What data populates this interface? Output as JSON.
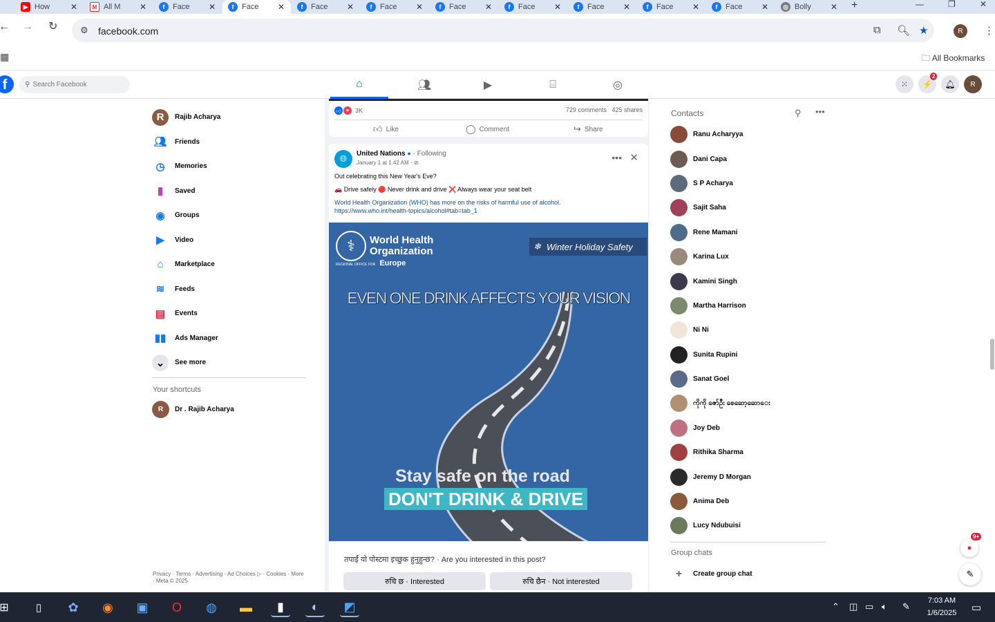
{
  "browser": {
    "tabs": [
      {
        "title": "How",
        "favicon": "youtube-icon",
        "active": false
      },
      {
        "title": "All M",
        "favicon": "gmail-icon",
        "active": false
      },
      {
        "title": "Face",
        "favicon": "facebook-icon",
        "active": false
      },
      {
        "title": "Face",
        "favicon": "facebook-icon",
        "active": true
      },
      {
        "title": "Face",
        "favicon": "facebook-icon",
        "active": false
      },
      {
        "title": "Face",
        "favicon": "facebook-icon",
        "active": false
      },
      {
        "title": "Face",
        "favicon": "facebook-icon",
        "active": false
      },
      {
        "title": "Face",
        "favicon": "facebook-icon",
        "active": false
      },
      {
        "title": "Face",
        "favicon": "facebook-icon",
        "active": false
      },
      {
        "title": "Face",
        "favicon": "facebook-icon",
        "active": false
      },
      {
        "title": "Face",
        "favicon": "facebook-icon",
        "active": false
      },
      {
        "title": "Bolly",
        "favicon": "globe-icon",
        "active": false
      }
    ],
    "url": "facebook.com",
    "bookmarks_label": "All Bookmarks"
  },
  "fb_header": {
    "search_placeholder": "Search Facebook",
    "messenger_badge": "2"
  },
  "left_nav": {
    "items": [
      {
        "label": "Rajib Acharya",
        "icon": "profile-avatar"
      },
      {
        "label": "Friends",
        "icon": "friends-icon"
      },
      {
        "label": "Memories",
        "icon": "clock-icon"
      },
      {
        "label": "Saved",
        "icon": "bookmark-icon"
      },
      {
        "label": "Groups",
        "icon": "groups-icon"
      },
      {
        "label": "Video",
        "icon": "video-icon"
      },
      {
        "label": "Marketplace",
        "icon": "marketplace-icon"
      },
      {
        "label": "Feeds",
        "icon": "feeds-icon"
      },
      {
        "label": "Events",
        "icon": "calendar-icon"
      },
      {
        "label": "Ads Manager",
        "icon": "bar-chart-icon"
      },
      {
        "label": "See more",
        "icon": "chevron-down-icon"
      }
    ],
    "shortcuts_title": "Your shortcuts",
    "shortcut": "Dr . Rajib Acharya",
    "footer": "Privacy · Terms · Advertising · Ad Choices ▷ · Cookies · More · Meta © 2025"
  },
  "top_card": {
    "reaction_count": "3K",
    "comments": "729 comments",
    "shares": "425 shares",
    "like": "Like",
    "comment": "Comment",
    "share": "Share"
  },
  "post": {
    "author": "United Nations",
    "following": "· Following",
    "date": "January 1 at 1:42 AM · ⊘",
    "line1": "Out celebrating this New Year's Eve?",
    "line2": "🚗 Drive safely 🔴 Never drink and drive ❌ Always wear your seat belt",
    "line3": "World Health Organization (WHO) has more on the risks of harmful use of alcohol.",
    "link": "https://www.who.int/health-topics/alcohol#tab=tab_1",
    "banner": {
      "org_line1": "World Health",
      "org_line2": "Organization",
      "org_region_small": "REGIONAL OFFICE FOR",
      "org_region": "Europe",
      "tag": "Winter Holiday Safety",
      "headline": "EVEN ONE DRINK AFFECTS YOUR VISION",
      "stay_safe": "Stay safe on the road",
      "dont_drink": "DON'T DRINK & DRIVE"
    },
    "survey_question": "तपाईं यो पोस्टमा इच्छुक हुनुहुन्छ? · Are you interested in this post?",
    "option_interested": "रुचि छ · Interested",
    "option_not_interested": "रुचि छैन · Not interested"
  },
  "contacts": {
    "title": "Contacts",
    "list": [
      "Ranu Acharyya",
      "Dani Capa",
      "S P Acharya",
      "Sajit Saha",
      "Rene Mamani",
      "Karina Lux",
      "Kamini Singh",
      "Martha Harrison",
      "Ni Ni",
      "Sunita Rupini",
      "Sanat Goel",
      "ကိုကို ဇော်ဦး စေဆော့ဆောေး",
      "Joy Deb",
      "Rithika Sharma",
      "Jeremy D Morgan",
      "Anima Deb",
      "Lucy Ndubuisi"
    ],
    "group_chats_title": "Group chats",
    "create_group": "Create group chat",
    "chat_badge": "9+"
  },
  "taskbar": {
    "time": "7:03 AM",
    "date": "1/6/2025"
  },
  "colors": {
    "fb_blue": "#0866ff",
    "banner_blue": "#3465a4",
    "teal_highlight": "#3eb7c4",
    "taskbar": "#1f2533"
  }
}
